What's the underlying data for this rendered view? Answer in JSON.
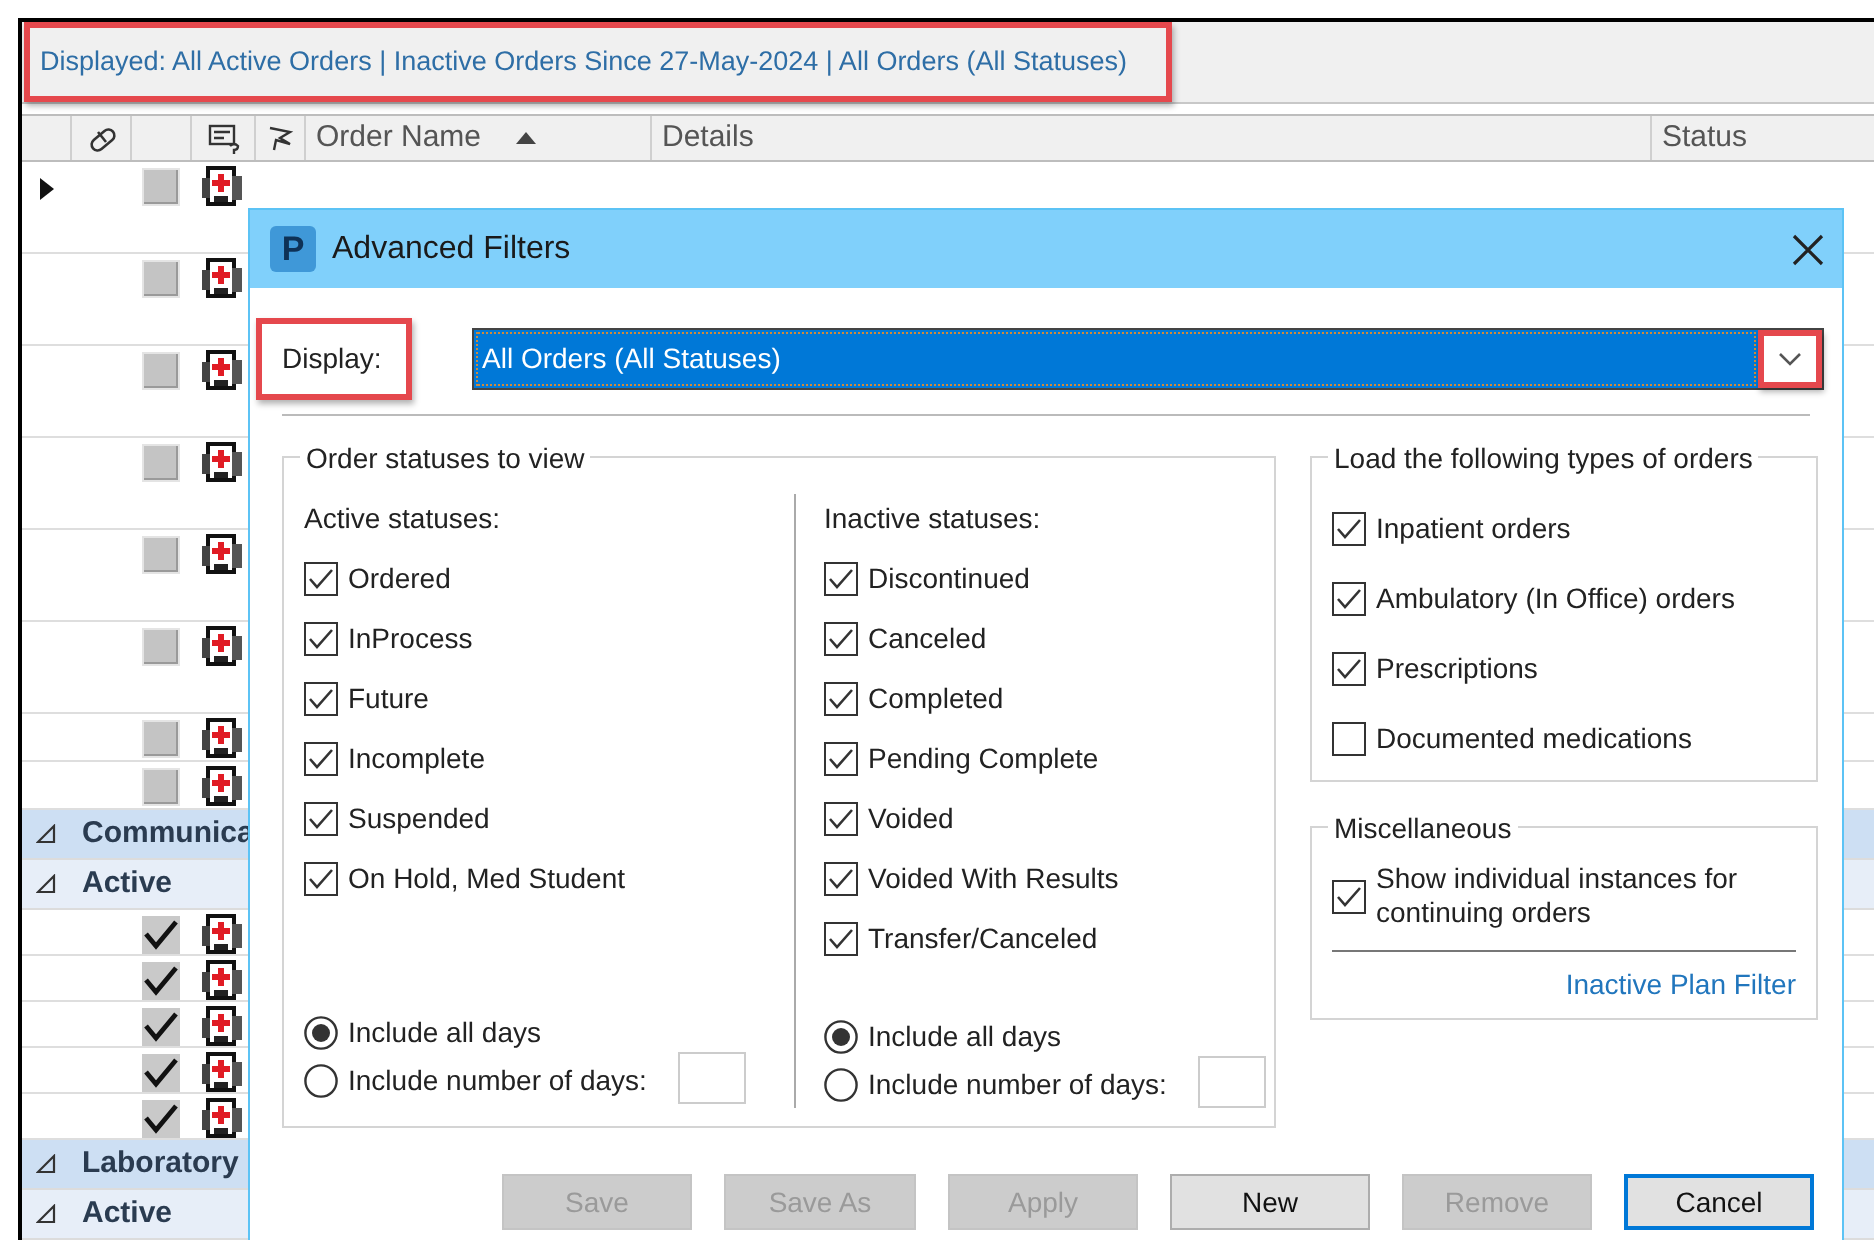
{
  "info_bar": {
    "text": "Displayed: All Active Orders | Inactive Orders Since 27-May-2024 | All Orders (All Statuses)",
    "annotated": true
  },
  "columns": [
    {
      "label": "Order Name",
      "sorted": true
    },
    {
      "label": "Details",
      "sorted": false
    },
    {
      "label": "Status",
      "sorted": false
    }
  ],
  "orders": [
    {
      "kind": "order",
      "current": true,
      "checked": false
    },
    {
      "kind": "order",
      "current": false,
      "checked": false
    },
    {
      "kind": "order",
      "current": false,
      "checked": false
    },
    {
      "kind": "order",
      "current": false,
      "checked": false
    },
    {
      "kind": "order",
      "current": false,
      "checked": false
    },
    {
      "kind": "order",
      "current": false,
      "checked": false
    },
    {
      "kind": "order",
      "current": false,
      "checked": false
    },
    {
      "kind": "order",
      "current": false,
      "checked": false
    },
    {
      "kind": "group",
      "label": "Communica",
      "expanded": true,
      "children": [
        {
          "kind": "group",
          "label": "Active",
          "expanded": true,
          "children": [
            {
              "kind": "order",
              "current": false,
              "checked": true
            },
            {
              "kind": "order",
              "current": false,
              "checked": true
            },
            {
              "kind": "order",
              "current": false,
              "checked": true
            },
            {
              "kind": "order",
              "current": false,
              "checked": true
            },
            {
              "kind": "order",
              "current": false,
              "checked": true
            }
          ]
        }
      ]
    },
    {
      "kind": "group",
      "label": "Laboratory",
      "expanded": true,
      "children": [
        {
          "kind": "group",
          "label": "Active",
          "expanded": true
        }
      ]
    }
  ],
  "dialog": {
    "logo": "P",
    "title": "Advanced Filters",
    "display": {
      "label": "Display:",
      "label_annotated": true,
      "value": "All Orders (All Statuses)",
      "focused": true,
      "arrow_annotated": true
    },
    "order_statuses": {
      "legend": "Order statuses to view",
      "groups": [
        {
          "heading": "Active statuses:",
          "items": [
            {
              "label": "Ordered",
              "checked": true
            },
            {
              "label": "InProcess",
              "checked": true
            },
            {
              "label": "Future",
              "checked": true
            },
            {
              "label": "Incomplete",
              "checked": true
            },
            {
              "label": "Suspended",
              "checked": true
            },
            {
              "label": "On Hold, Med Student",
              "checked": true
            }
          ],
          "radios": [
            {
              "label": "Include all days",
              "selected": true
            },
            {
              "label": "Include number of days:",
              "selected": false
            }
          ]
        },
        {
          "heading": "Inactive statuses:",
          "items": [
            {
              "label": "Discontinued",
              "checked": true
            },
            {
              "label": "Canceled",
              "checked": true
            },
            {
              "label": "Completed",
              "checked": true
            },
            {
              "label": "Pending Complete",
              "checked": true
            },
            {
              "label": "Voided",
              "checked": true
            },
            {
              "label": "Voided With Results",
              "checked": true
            },
            {
              "label": "Transfer/Canceled",
              "checked": true
            }
          ],
          "radios": [
            {
              "label": "Include all days",
              "selected": true
            },
            {
              "label": "Include number of days:",
              "selected": false
            }
          ]
        }
      ]
    },
    "order_types": {
      "legend": "Load the following types of orders",
      "items": [
        {
          "label": "Inpatient orders",
          "checked": true
        },
        {
          "label": "Ambulatory (In Office) orders",
          "checked": true
        },
        {
          "label": "Prescriptions",
          "checked": true
        },
        {
          "label": "Documented medications",
          "checked": false
        }
      ]
    },
    "miscellaneous": {
      "legend": "Miscellaneous",
      "items": [
        {
          "label": "Show individual instances for continuing orders",
          "checked": true
        }
      ],
      "link": "Inactive Plan Filter"
    },
    "buttons": [
      {
        "label": "Save",
        "disabled": true,
        "default": false
      },
      {
        "label": "Save As",
        "disabled": true,
        "default": false
      },
      {
        "label": "Apply",
        "disabled": true,
        "default": false
      },
      {
        "label": "New",
        "disabled": false,
        "default": false
      },
      {
        "label": "Remove",
        "disabled": true,
        "default": false
      },
      {
        "label": "Cancel",
        "disabled": false,
        "default": true
      }
    ]
  }
}
